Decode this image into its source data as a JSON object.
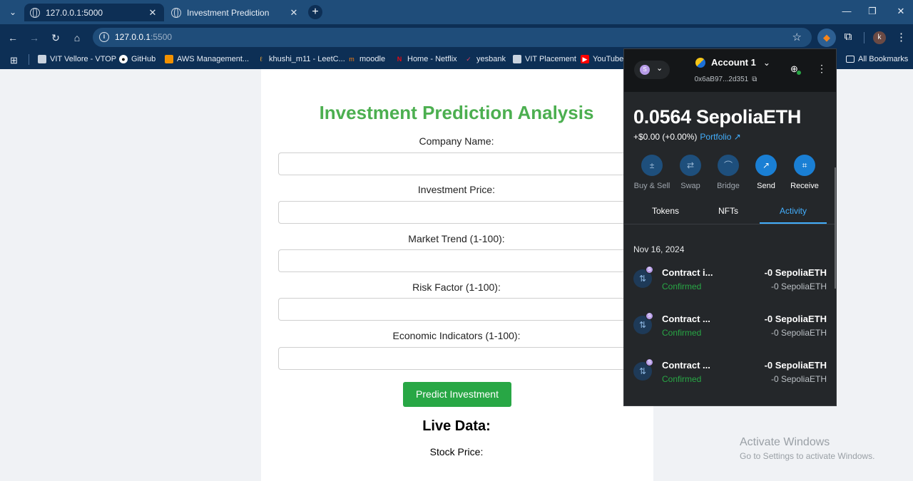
{
  "browser": {
    "tabs": [
      {
        "label": "127.0.0.1:5000",
        "close": "✕"
      },
      {
        "label": "Investment Prediction",
        "close": "✕"
      }
    ],
    "new_tab": "+",
    "url_host": "127.0.0.1",
    "url_port": ":5500",
    "bookmarks": [
      {
        "label": "VIT Vellore - VTOP",
        "icon": "vit-icon"
      },
      {
        "label": "GitHub",
        "icon": "github-icon"
      },
      {
        "label": "AWS Management...",
        "icon": "aws-icon"
      },
      {
        "label": "khushi_m11 - LeetC...",
        "icon": "leetcode-icon"
      },
      {
        "label": "moodle",
        "icon": "moodle-icon"
      },
      {
        "label": "Home - Netflix",
        "icon": "netflix-icon"
      },
      {
        "label": "yesbank",
        "icon": "yesbank-icon"
      },
      {
        "label": "VIT Placement",
        "icon": "vit-icon"
      },
      {
        "label": "YouTube",
        "icon": "youtube-icon"
      },
      {
        "label": "All Bookmarks",
        "icon": "folder-icon"
      }
    ],
    "profile_initial": "k",
    "colors": {
      "tabstrip": "#1f4d7a",
      "toolbar": "#0d2f55"
    }
  },
  "page": {
    "title": "Investment Prediction Analysis",
    "fields": [
      {
        "label": "Company Name:",
        "value": ""
      },
      {
        "label": "Investment Price:",
        "value": ""
      },
      {
        "label": "Market Trend (1-100):",
        "value": ""
      },
      {
        "label": "Risk Factor (1-100):",
        "value": ""
      },
      {
        "label": "Economic Indicators (1-100):",
        "value": ""
      }
    ],
    "predict_button": "Predict Investment",
    "live_title": "Live Data:",
    "stock_label": "Stock Price:",
    "colors": {
      "title": "#4caf50",
      "button": "#28a745"
    }
  },
  "watermark": {
    "line1": "Activate Windows",
    "line2": "Go to Settings to activate Windows."
  },
  "metamask": {
    "account_name": "Account 1",
    "address": "0x6aB97...2d351",
    "network_initial": "S",
    "balance": "0.0564 SepoliaETH",
    "fiat": "+$0.00 (+0.00%)",
    "portfolio": "Portfolio",
    "actions": [
      {
        "label": "Buy & Sell",
        "icon": "buy-sell-icon"
      },
      {
        "label": "Swap",
        "icon": "swap-icon"
      },
      {
        "label": "Bridge",
        "icon": "bridge-icon"
      },
      {
        "label": "Send",
        "icon": "send-icon"
      },
      {
        "label": "Receive",
        "icon": "receive-icon"
      }
    ],
    "tabs": [
      "Tokens",
      "NFTs",
      "Activity"
    ],
    "active_tab": "Activity",
    "activity_date": "Nov 16, 2024",
    "transactions": [
      {
        "name": "Contract i...",
        "status": "Confirmed",
        "amount": "-0 SepoliaETH",
        "amount2": "-0 SepoliaETH"
      },
      {
        "name": "Contract ...",
        "status": "Confirmed",
        "amount": "-0 SepoliaETH",
        "amount2": "-0 SepoliaETH"
      },
      {
        "name": "Contract ...",
        "status": "Confirmed",
        "amount": "-0 SepoliaETH",
        "amount2": "-0 SepoliaETH"
      }
    ],
    "colors": {
      "accent": "#43aefc",
      "confirmed": "#28a745",
      "background": "#24272a"
    }
  }
}
